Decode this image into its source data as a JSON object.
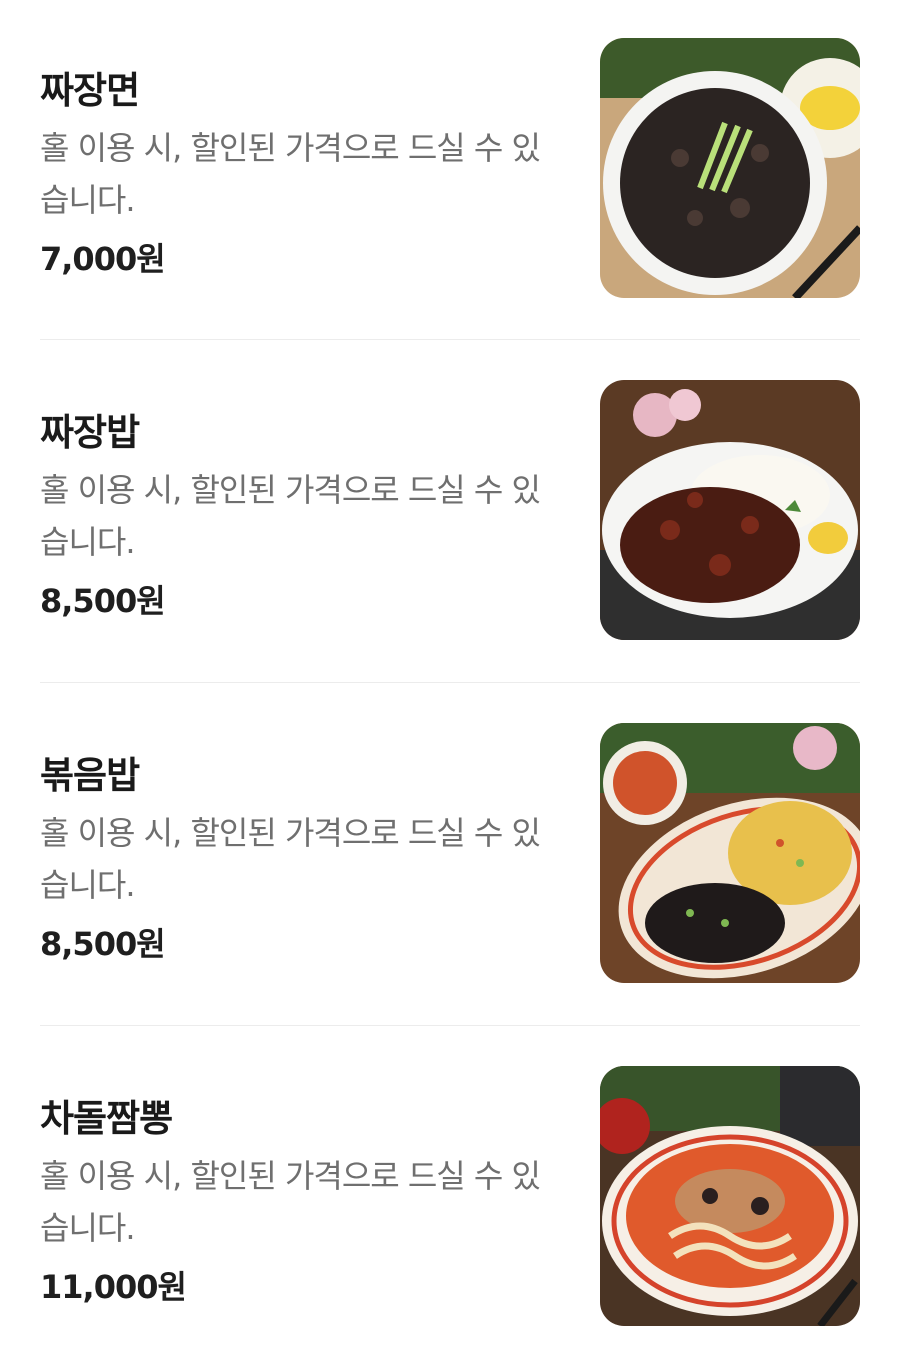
{
  "menu": {
    "items": [
      {
        "name": "짜장면",
        "description": "홀 이용 시, 할인된 가격으로 드실 수 있습니다.",
        "price": "7,000원",
        "photo_icon": "jajangmyeon-photo"
      },
      {
        "name": "짜장밥",
        "description": "홀 이용 시, 할인된 가격으로 드실 수 있습니다.",
        "price": "8,500원",
        "photo_icon": "jajangbap-photo"
      },
      {
        "name": "볶음밥",
        "description": "홀 이용 시, 할인된 가격으로 드실 수 있습니다.",
        "price": "8,500원",
        "photo_icon": "fried-rice-photo"
      },
      {
        "name": "차돌짬뽕",
        "description": "홀 이용 시, 할인된 가격으로 드실 수 있습니다.",
        "price": "11,000원",
        "photo_icon": "chadol-jjamppong-photo"
      }
    ]
  }
}
